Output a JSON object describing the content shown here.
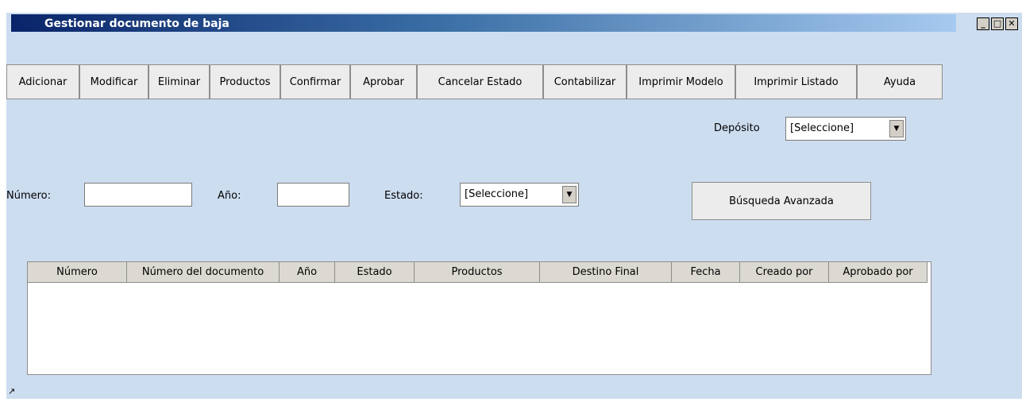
{
  "window": {
    "title": "Gestionar documento de baja"
  },
  "toolbar": {
    "buttons": [
      "Adicionar",
      "Modificar",
      "Eliminar",
      "Productos",
      "Confirmar",
      "Aprobar",
      "Cancelar Estado",
      "Contabilizar",
      "Imprimir Modelo",
      "Imprimir Listado",
      "Ayuda"
    ]
  },
  "deposito": {
    "label": "Depósito",
    "value": "[Seleccione]"
  },
  "filters": {
    "numero_label": "Número:",
    "numero_value": "",
    "anio_label": "Año:",
    "anio_value": "",
    "estado_label": "Estado:",
    "estado_value": "[Seleccione]",
    "advanced_search": "Búsqueda Avanzada"
  },
  "table": {
    "columns": [
      "Número",
      "Número del documento",
      "Año",
      "Estado",
      "Productos",
      "Destino Final",
      "Fecha",
      "Creado por",
      "Aprobado por"
    ],
    "rows": []
  }
}
